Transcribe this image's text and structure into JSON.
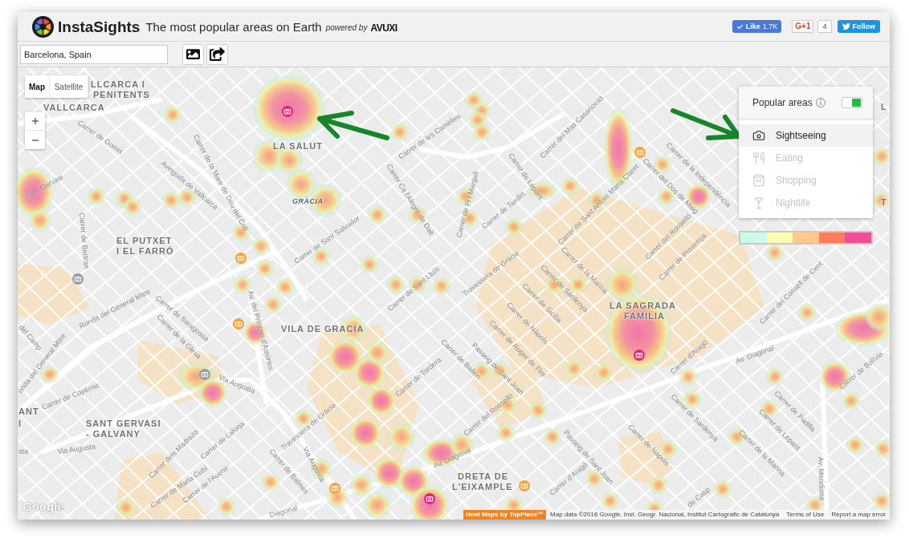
{
  "header": {
    "app_name": "InstaSights",
    "tagline": "The most popular areas on Earth",
    "powered_by": "powered by",
    "partner": "AVUXI",
    "social": {
      "like": {
        "label": "Like",
        "count": "1.7K"
      },
      "plus_one": {
        "label": "G+1",
        "count": "4"
      },
      "follow": {
        "label": "Follow"
      }
    }
  },
  "toolbar": {
    "location_field": {
      "value": "Barcelona, Spain"
    },
    "buttons": [
      {
        "kind": "image"
      },
      {
        "kind": "share"
      }
    ]
  },
  "map": {
    "type_tabs": [
      {
        "label": "Map",
        "selected": true
      },
      {
        "label": "Satellite",
        "selected": false
      }
    ],
    "district_labels": [
      "LLCARCA I",
      "PENITENTS",
      "VALLCARCA",
      "LA SALUT",
      "GRÀCIA",
      "EL PUTXET",
      "I EL FARRÓ",
      "VILA DE GRACIA",
      "ANT",
      "I",
      "SANT GERVASI",
      "- GALVANY",
      "LA SAGRADA",
      "FAMILIA",
      "DRETA DE",
      "L'EIXAMPLE",
      "L",
      "T"
    ],
    "street_labels": [
      "Carrer de Gomis",
      "Avinguda de Vallcarca",
      "Carrer de la Mare de Déu del Coll",
      "Sant Gervasi",
      "Carrer de Sant Salvador",
      "Carrer Ca l'Alegre de Dalt",
      "Carrer de les Camèlies",
      "Carrer de Bertran",
      "Ronda del General Mitre",
      "Carrer de Sant Lluís",
      "Av. del Príncep d'Astúries",
      "onda del General Mitre",
      "Carrer de Copèrnic",
      "del Camp",
      "Carrer de Saragossa",
      "Carrer de la Gleva",
      "Via Augusta",
      "Via Augusta",
      "sta",
      "Carrer dels Madrazo",
      "Carrer de Laforja",
      "Carrer de Maria Cubí",
      "Carrer de l'Avenir",
      "Carrer de Balmes",
      "Via Augusta",
      "Travessera de Gràcia",
      "Carrer de Tordera",
      "Diagonal",
      "Av. Diagonal",
      "Carrer del Mas Casanovas",
      "Carrer de Pi i Margall",
      "Carrer de Lepant",
      "Carrer de Taxdirt",
      "Carrer de Sant Antoni Maria Claret",
      "Carrer de la Independència",
      "Carrer del Dos de Maig",
      "Carrer del Rosselló",
      "Carrer de Provença",
      "Travessera de Gràcia",
      "Carrer de la Marina",
      "Carrer de Sardenya",
      "Carrer de Sicília",
      "Carrer de Nàpols",
      "Carrer de Roger de Flor",
      "Passeig de Sant Joan",
      "Carrer de Bailèn",
      "Carrer d'Aragó",
      "Av. Diagonal",
      "Carrer de Bolívia",
      "Carrer de Padilla",
      "Carrer de Lepant",
      "Carrer de la Marina",
      "Carrer de Sardenya",
      "Carrer de Nàpols",
      "de Casp",
      "Carrer d'Aragó",
      "Passeig de Sant Joan",
      "Carrer del Rosselló",
      "Av. Meridiana",
      "Carrer del Consell de Cent"
    ],
    "google_logo": "Google",
    "heatmap_credit": "Heat Maps by TopPlace™",
    "map_data": "Map data ©2016 Google, Inst. Geogr. Nacional, Institut Cartografic de Catalunya",
    "terms": "Terms of Use",
    "report": "Report a map error"
  },
  "popular_areas": {
    "title": "Popular areas",
    "on": true,
    "categories": [
      {
        "label": "Sightseeing",
        "kind": "camera",
        "selected": true,
        "disabled": false
      },
      {
        "label": "Eating",
        "kind": "utensils",
        "selected": false,
        "disabled": true
      },
      {
        "label": "Shopping",
        "kind": "bag",
        "selected": false,
        "disabled": true
      },
      {
        "label": "Nightlife",
        "kind": "glass",
        "selected": false,
        "disabled": true
      }
    ],
    "legend": [
      {
        "color": "#cdf9e8"
      },
      {
        "color": "#fefdb8"
      },
      {
        "color": "#fec98a"
      },
      {
        "color": "#ff7c5c"
      },
      {
        "color": "#f14f95"
      }
    ]
  }
}
